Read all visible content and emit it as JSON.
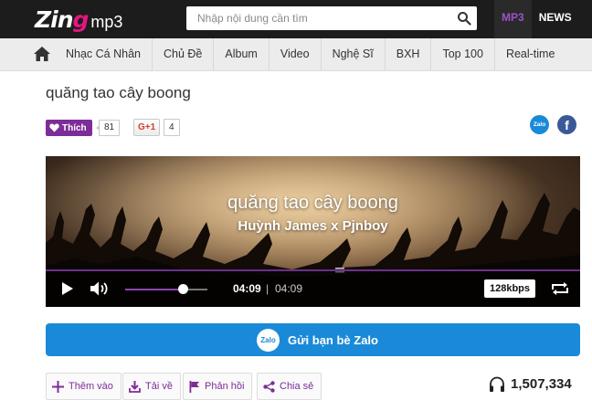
{
  "header": {
    "logo": {
      "brand": "Zing",
      "brand_letters": [
        "Z",
        "in",
        "g"
      ],
      "product": "mp3"
    },
    "search": {
      "placeholder": "Nhập nội dung cần tìm",
      "value": ""
    },
    "links": [
      {
        "label": "MP3",
        "active": true
      },
      {
        "label": "NEWS",
        "active": false
      }
    ]
  },
  "nav": {
    "items": [
      "Nhạc Cá Nhân",
      "Chủ Đề",
      "Album",
      "Video",
      "Nghệ Sĩ",
      "BXH",
      "Top 100",
      "Real-time"
    ]
  },
  "song": {
    "title": "quăng tao cây boong",
    "artist": "Huỳnh James x Pjnboy"
  },
  "social": {
    "like_label": "Thích",
    "like_count": "81",
    "gplus_label": "G+1",
    "gplus_count": "4",
    "zalo_label": "Zalo",
    "facebook_label": "f"
  },
  "player": {
    "current_time": "04:09",
    "separator": "|",
    "duration": "04:09",
    "progress_fraction": 1.0,
    "volume_fraction": 0.7,
    "quality": "128kbps"
  },
  "zalo_send": {
    "icon_label": "Zalo",
    "label": "Gửi bạn bè Zalo"
  },
  "actions": [
    {
      "label": "Thêm vào",
      "icon": "plus-icon"
    },
    {
      "label": "Tải về",
      "icon": "download-icon"
    },
    {
      "label": "Phản hồi",
      "icon": "flag-icon"
    },
    {
      "label": "Chia sẻ",
      "icon": "share-icon"
    }
  ],
  "listen_count": "1,507,334",
  "colors": {
    "brand_purple": "#7d2d97",
    "zalo_blue": "#1a8ad8",
    "facebook_blue": "#3b5998",
    "topbar": "#1c1c1c"
  }
}
